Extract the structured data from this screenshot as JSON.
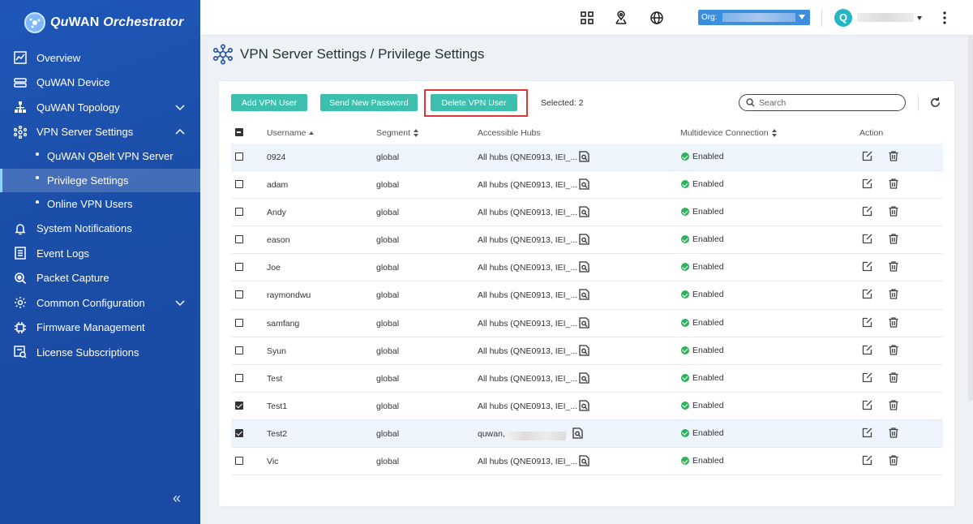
{
  "brand": {
    "name_a": "Qu",
    "name_b": "WAN",
    "name_c": " Orchestrator"
  },
  "sidebar": {
    "items": [
      {
        "label": "Overview",
        "icon": "chart-icon"
      },
      {
        "label": "QuWAN Device",
        "icon": "device-icon"
      },
      {
        "label": "QuWAN Topology",
        "icon": "topology-icon",
        "expandable": true
      },
      {
        "label": "VPN Server Settings",
        "icon": "vpn-icon",
        "expanded": true
      },
      {
        "label": "System Notifications",
        "icon": "bell-icon"
      },
      {
        "label": "Event Logs",
        "icon": "log-icon"
      },
      {
        "label": "Packet Capture",
        "icon": "capture-icon"
      },
      {
        "label": "Common Configuration",
        "icon": "gear-icon",
        "expandable": true
      },
      {
        "label": "Firmware Management",
        "icon": "chip-icon"
      },
      {
        "label": "License Subscriptions",
        "icon": "license-icon"
      }
    ],
    "sub_items": [
      {
        "label": "QuWAN QBelt VPN Server"
      },
      {
        "label": "Privilege Settings",
        "active": true
      },
      {
        "label": "Online VPN Users"
      }
    ]
  },
  "topbar": {
    "org_label": "Org:",
    "avatar_letter": "Q"
  },
  "page": {
    "title": "VPN Server Settings / Privilege Settings"
  },
  "toolbar": {
    "add_label": "Add VPN User",
    "send_label": "Send New Password",
    "delete_label": "Delete VPN User",
    "selected_text": "Selected: 2",
    "search_placeholder": "Search"
  },
  "table": {
    "headers": {
      "username": "Username",
      "segment": "Segment",
      "hubs": "Accessible Hubs",
      "multi": "Multidevice Connection",
      "action": "Action"
    },
    "rows": [
      {
        "username": "0924",
        "segment": "global",
        "hubs": "All hubs (QNE0913, IEI_...",
        "multi": "Enabled",
        "checked": false,
        "highlight": true
      },
      {
        "username": "adam",
        "segment": "global",
        "hubs": "All hubs (QNE0913, IEI_...",
        "multi": "Enabled",
        "checked": false
      },
      {
        "username": "Andy",
        "segment": "global",
        "hubs": "All hubs (QNE0913, IEI_...",
        "multi": "Enabled",
        "checked": false
      },
      {
        "username": "eason",
        "segment": "global",
        "hubs": "All hubs (QNE0913, IEI_...",
        "multi": "Enabled",
        "checked": false
      },
      {
        "username": "Joe",
        "segment": "global",
        "hubs": "All hubs (QNE0913, IEI_...",
        "multi": "Enabled",
        "checked": false
      },
      {
        "username": "raymondwu",
        "segment": "global",
        "hubs": "All hubs (QNE0913, IEI_...",
        "multi": "Enabled",
        "checked": false
      },
      {
        "username": "samfang",
        "segment": "global",
        "hubs": "All hubs (QNE0913, IEI_...",
        "multi": "Enabled",
        "checked": false
      },
      {
        "username": "Syun",
        "segment": "global",
        "hubs": "All hubs (QNE0913, IEI_...",
        "multi": "Enabled",
        "checked": false
      },
      {
        "username": "Test",
        "segment": "global",
        "hubs": "All hubs (QNE0913, IEI_...",
        "multi": "Enabled",
        "checked": false
      },
      {
        "username": "Test1",
        "segment": "global",
        "hubs": "All hubs (QNE0913, IEI_...",
        "multi": "Enabled",
        "checked": true
      },
      {
        "username": "Test2",
        "segment": "global",
        "hubs": "quwan,",
        "multi": "Enabled",
        "checked": true,
        "highlight": true,
        "blurred": true
      },
      {
        "username": "Vic",
        "segment": "global",
        "hubs": "All hubs (QNE0913, IEI_...",
        "multi": "Enabled",
        "checked": false
      }
    ]
  },
  "colors": {
    "sidebar": "#1f57b8",
    "accent": "#3dbfae",
    "highlight_box": "#e0353a",
    "ok": "#2db25a"
  }
}
